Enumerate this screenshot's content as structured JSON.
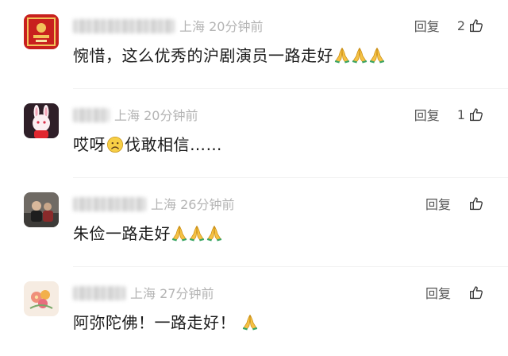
{
  "comments": [
    {
      "location": "上海",
      "time": "20分钟前",
      "reply_label": "回复",
      "likes": "2",
      "text": "惋惜，这么优秀的沪剧演员一路走好",
      "emoji_count": 3,
      "avatar_icon": "red-poster-avatar"
    },
    {
      "location": "上海",
      "time": "20分钟前",
      "reply_label": "回复",
      "likes": "1",
      "text_before": "哎呀",
      "text_after": "伐敢相信……",
      "avatar_icon": "rabbit-avatar"
    },
    {
      "location": "上海",
      "time": "26分钟前",
      "reply_label": "回复",
      "text": "朱俭一路走好",
      "emoji_count": 3,
      "avatar_icon": "photo-avatar"
    },
    {
      "location": "上海",
      "time": "27分钟前",
      "reply_label": "回复",
      "text": "阿弥陀佛！一路走好！",
      "emoji_count": 1,
      "avatar_icon": "flower-avatar"
    }
  ],
  "colors": {
    "text": "#1a1a1a",
    "meta": "#b4b4b4",
    "action": "#555555"
  }
}
